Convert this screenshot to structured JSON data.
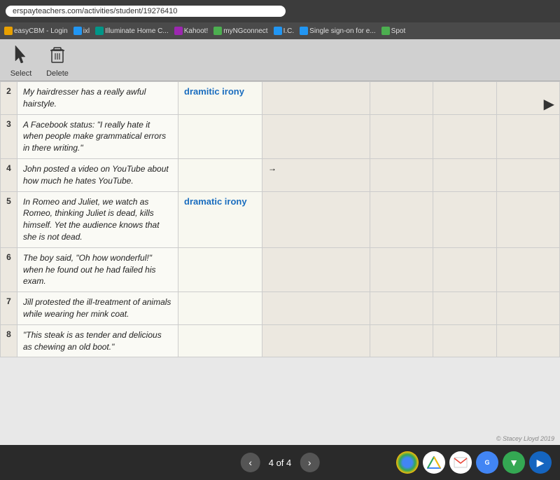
{
  "browser": {
    "url": "erspayteachers.com/activities/student/19276410"
  },
  "bookmarks": [
    {
      "label": "easyCBM - Login",
      "color": "orange"
    },
    {
      "label": "ixl",
      "color": "blue"
    },
    {
      "label": "Illuminate Home C...",
      "color": "teal"
    },
    {
      "label": "Kahoot!",
      "color": "purple"
    },
    {
      "label": "myNGconnect",
      "color": "green"
    },
    {
      "label": "I.C.",
      "color": "blue"
    },
    {
      "label": "Single sign-on for e...",
      "color": "blue"
    },
    {
      "label": "Spot",
      "color": "green"
    }
  ],
  "toolbar": {
    "select_label": "Select",
    "delete_label": "Delete"
  },
  "table": {
    "rows": [
      {
        "num": "2",
        "text": "My hairdresser has a really awful hairstyle.",
        "answer": "dramitic irony",
        "col3": "",
        "col4": "",
        "col5": "",
        "col6": ""
      },
      {
        "num": "3",
        "text": "A Facebook status: \"I really hate it when people make grammatical errors in there writing.\"",
        "answer": "",
        "col3": "",
        "col4": "",
        "col5": "",
        "col6": ""
      },
      {
        "num": "4",
        "text": "John posted a video on YouTube about how much he hates YouTube.",
        "answer": "",
        "col3": "→",
        "col4": "",
        "col5": "",
        "col6": ""
      },
      {
        "num": "5",
        "text": "In Romeo and Juliet, we watch as Romeo, thinking Juliet is dead, kills himself. Yet the audience knows that she is not dead.",
        "answer": "dramatic irony",
        "col3": "",
        "col4": "",
        "col5": "",
        "col6": ""
      },
      {
        "num": "6",
        "text": "The boy said, \"Oh how wonderful!\" when he found out he had failed his exam.",
        "answer": "",
        "col3": "",
        "col4": "",
        "col5": "",
        "col6": ""
      },
      {
        "num": "7",
        "text": "Jill protested the ill-treatment of animals while wearing her mink coat.",
        "answer": "",
        "col3": "",
        "col4": "",
        "col5": "",
        "col6": ""
      },
      {
        "num": "8",
        "text": "\"This steak is as tender and delicious as chewing an old boot.\"",
        "answer": "",
        "col3": "",
        "col4": "",
        "col5": "",
        "col6": ""
      }
    ]
  },
  "navigation": {
    "current": "4 of 4",
    "prev_label": "‹",
    "next_label": "›"
  },
  "watermark": "© Stacey Lloyd 2019"
}
